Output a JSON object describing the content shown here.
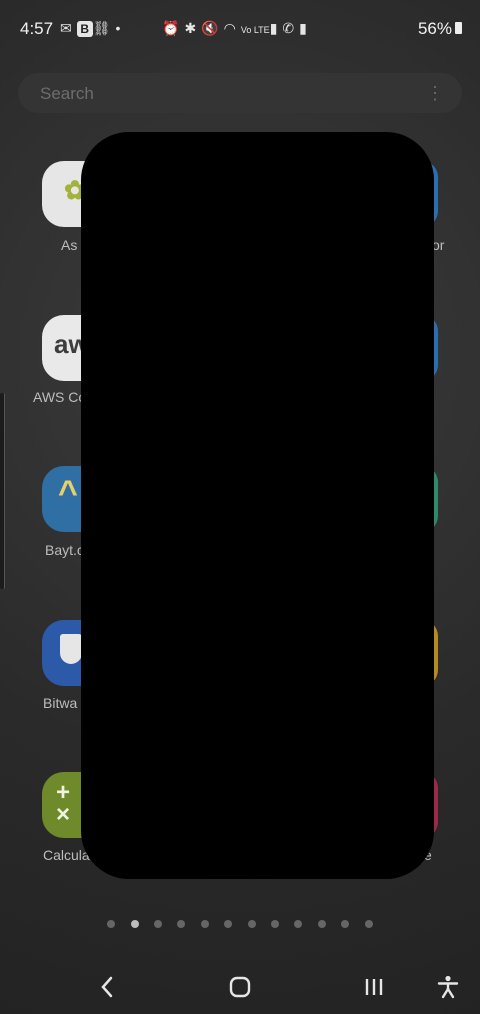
{
  "status_bar": {
    "time": "4:57",
    "left_icons": [
      "gmail-icon",
      "b-icon",
      "link-off-icon",
      "dot-icon"
    ],
    "b_letter": "B",
    "right_icons": [
      "alarm-icon",
      "bluetooth-icon",
      "mute-icon",
      "wifi-icon",
      "volte-icon",
      "signal-icon",
      "call-icon",
      "signal-icon"
    ],
    "battery_percent": "56%"
  },
  "search": {
    "placeholder": "Search"
  },
  "apps": [
    {
      "label_fragment": "As",
      "right_fragment": "or"
    },
    {
      "label_fragment": "AWS Co"
    },
    {
      "label_fragment": "Bayt.c"
    },
    {
      "label_fragment": "Bitwa"
    },
    {
      "label_fragment": "Calcula",
      "right_fragment": "e"
    }
  ],
  "page_indicator": {
    "total": 12,
    "active_index": 1
  },
  "nav": {
    "back": "back-icon",
    "home": "home-icon",
    "recents": "recents-icon",
    "accessibility": "accessibility-icon"
  }
}
